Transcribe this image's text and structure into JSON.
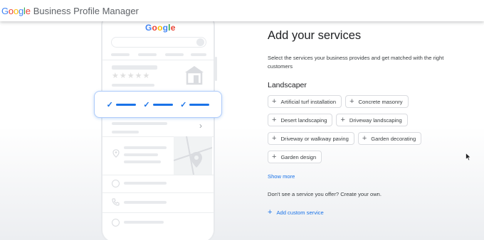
{
  "header": {
    "brand_google": "Google",
    "brand_product": "Business Profile Manager"
  },
  "illustration": {
    "google_logo": "Google",
    "stars": "★★★★★",
    "checks": [
      "✓",
      "✓",
      "✓"
    ]
  },
  "main": {
    "title": "Add your services",
    "description": "Select the services your business provides and get matched with the right customers",
    "category": "Landscaper",
    "services": [
      [
        "Artificial turf installation",
        "Concrete masonry"
      ],
      [
        "Desert landscaping",
        "Driveway landscaping"
      ],
      [
        "Driveway or walkway paving",
        "Garden decorating"
      ],
      [
        "Garden design"
      ]
    ],
    "show_more": "Show more",
    "custom_prompt": "Don't see a service you offer? Create your own.",
    "add_custom": "Add custom service"
  },
  "colors": {
    "google_blue": "#4285F4",
    "google_red": "#EA4335",
    "google_yellow": "#FBBC05",
    "google_green": "#34A853",
    "link_blue": "#1a73e8"
  },
  "icons": {
    "chip_icon": "plus-icon",
    "cursor": "mouse-pointer-icon"
  }
}
